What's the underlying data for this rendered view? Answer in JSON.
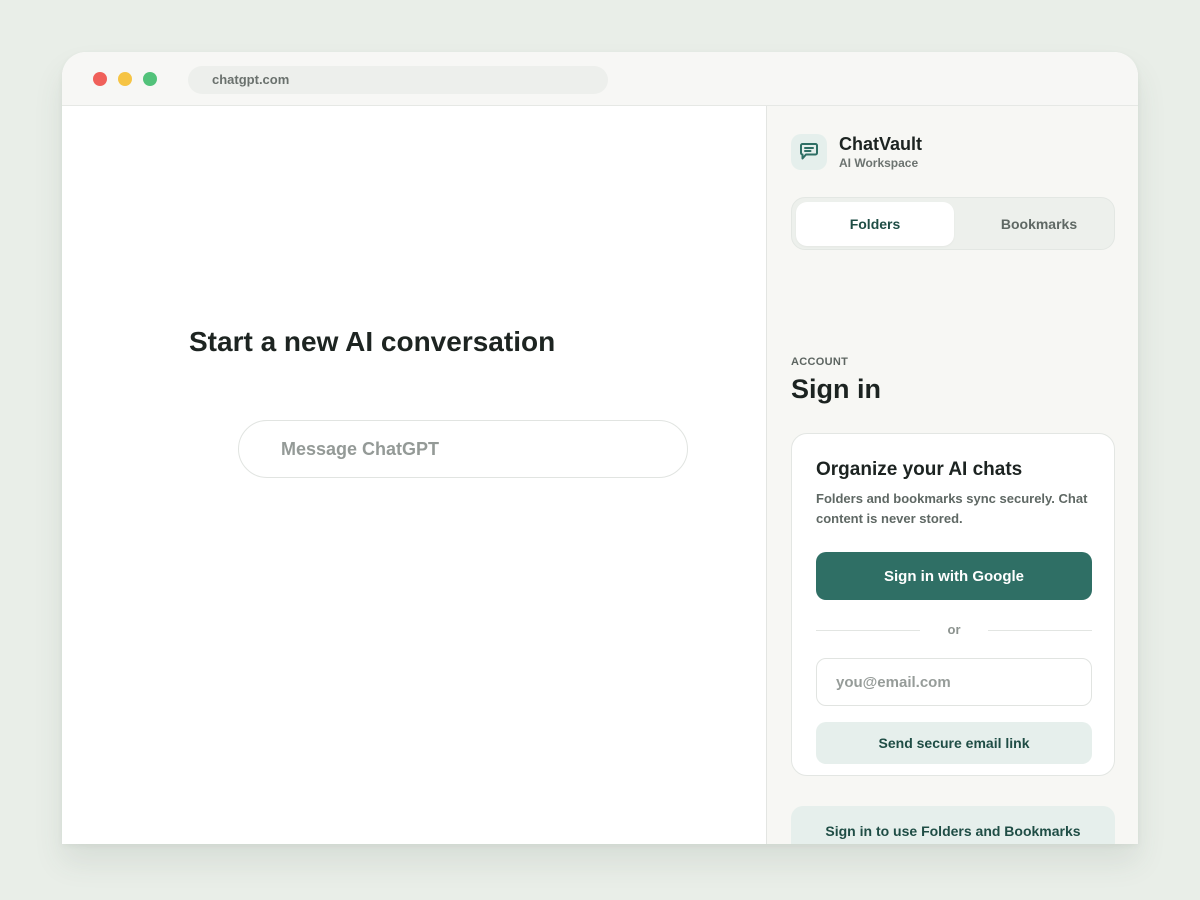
{
  "browser": {
    "url": "chatgpt.com"
  },
  "main": {
    "headline": "Start a new AI conversation",
    "message_placeholder": "Message ChatGPT"
  },
  "panel": {
    "brand": {
      "name": "ChatVault",
      "subtitle": "AI Workspace",
      "icon": "chat-bubble-icon"
    },
    "tabs": [
      {
        "label": "Folders",
        "active": true
      },
      {
        "label": "Bookmarks",
        "active": false
      }
    ],
    "eyebrow": "ACCOUNT",
    "title": "Sign in",
    "card": {
      "title": "Organize your AI chats",
      "description": "Folders and bookmarks sync securely. Chat content is never stored.",
      "google_button": "Sign in with Google",
      "divider": "or",
      "email_placeholder": "you@email.com",
      "email_button": "Send secure email link"
    },
    "footer_notice": "Sign in to use Folders and Bookmarks"
  },
  "colors": {
    "accent": "#2f6f65",
    "accent_soft": "#e6efec",
    "traffic_red": "#f0605a",
    "traffic_yellow": "#f6c444",
    "traffic_green": "#52c27a"
  }
}
